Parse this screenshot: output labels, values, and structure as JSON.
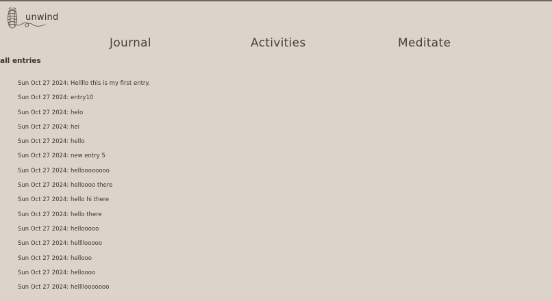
{
  "app": {
    "name": "unwind",
    "logo_icon": "yarn-ball-icon"
  },
  "nav": {
    "items": [
      {
        "id": "journal",
        "label": "Journal"
      },
      {
        "id": "activities",
        "label": "Activities"
      },
      {
        "id": "meditate",
        "label": "Meditate"
      }
    ]
  },
  "main": {
    "section_title": "all entries",
    "entries": [
      "Sun Oct 27 2024: Hellllo this is my first entry.",
      "Sun Oct 27 2024: entry10",
      "Sun Oct 27 2024: helo",
      "Sun Oct 27 2024: hei",
      "Sun Oct 27 2024: hello",
      "Sun Oct 27 2024: new entry 5",
      "Sun Oct 27 2024: helloooooooo",
      "Sun Oct 27 2024: helloooo there",
      "Sun Oct 27 2024: hello hi there",
      "Sun Oct 27 2024: hello there",
      "Sun Oct 27 2024: hellooooo",
      "Sun Oct 27 2024: hellllooooo",
      "Sun Oct 27 2024: hellooo",
      "Sun Oct 27 2024: helloooo",
      "Sun Oct 27 2024: hellllooooooo"
    ]
  },
  "colors": {
    "background": "#dcd3ca",
    "text": "#3b3430",
    "top_border": "#6f6862"
  }
}
